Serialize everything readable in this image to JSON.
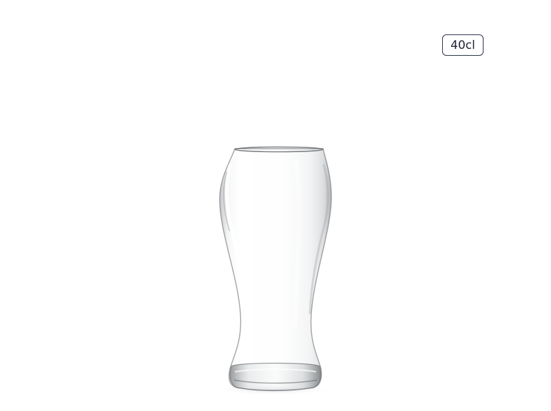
{
  "product": {
    "capacity_label": "40cl",
    "image_subject": "beer-glass"
  },
  "colors": {
    "background": "#ffffff",
    "badge_border": "#2b3347",
    "badge_text": "#1d2233"
  }
}
